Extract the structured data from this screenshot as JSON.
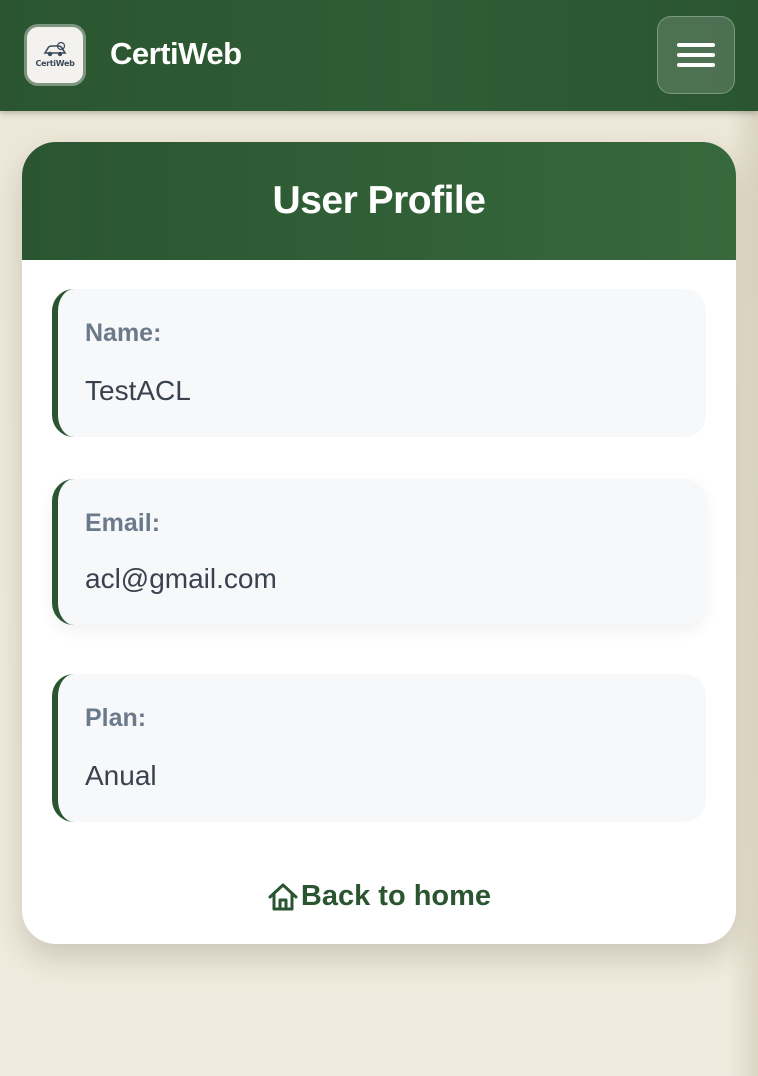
{
  "header": {
    "logo_text": "CertiWeb",
    "brand": "CertiWeb",
    "menu_icon": "hamburger-menu-icon"
  },
  "profile": {
    "title": "User Profile",
    "fields": [
      {
        "label": "Name:",
        "value": "TestACL"
      },
      {
        "label": "Email:",
        "value": "acl@gmail.com"
      },
      {
        "label": "Plan:",
        "value": "Anual"
      }
    ],
    "back_label": "Back to home",
    "back_icon": "home-icon"
  },
  "colors": {
    "primary": "#2a5530",
    "accent": "#37693d",
    "label": "#6b7a8a",
    "value": "#3a4250",
    "field_bg": "#f7f8fa",
    "page_bg": "#ece7d8"
  }
}
